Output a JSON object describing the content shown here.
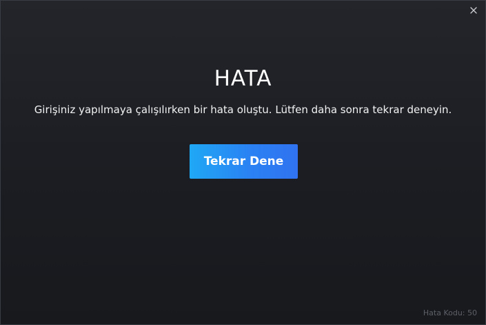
{
  "dialog": {
    "title": "HATA",
    "message": "Girişiniz yapılmaya çalışılırken bir hata oluştu. Lütfen daha sonra tekrar deneyin.",
    "retry_label": "Tekrar Dene",
    "error_code": "Hata Kodu: 50",
    "close_icon": "close-icon"
  },
  "colors": {
    "background": "#1c1e23",
    "button_start": "#1fa8f5",
    "button_end": "#3072f0",
    "muted_text": "#5d6068"
  }
}
